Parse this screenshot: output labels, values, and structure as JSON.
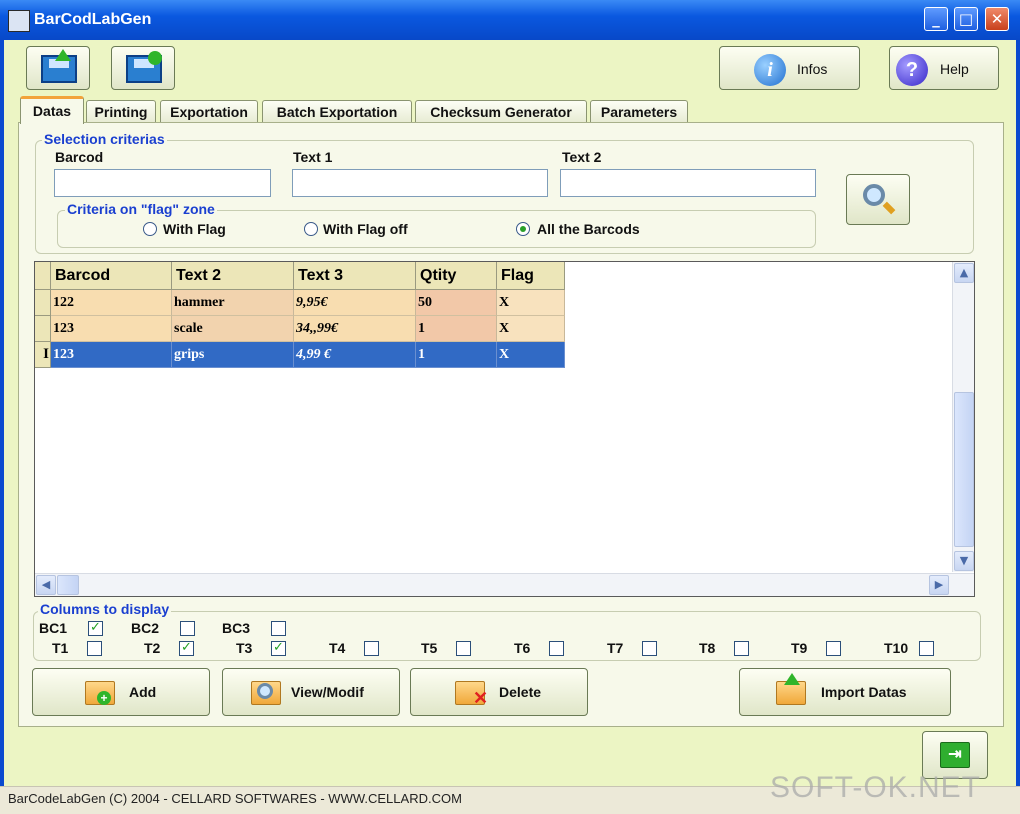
{
  "window": {
    "title": "BarCodLabGen"
  },
  "toolbar": {
    "infos_label": "Infos",
    "help_label": "Help"
  },
  "tabs": [
    {
      "label": "Datas",
      "active": true
    },
    {
      "label": "Printing"
    },
    {
      "label": "Exportation"
    },
    {
      "label": "Batch Exportation"
    },
    {
      "label": "Checksum Generator"
    },
    {
      "label": "Parameters"
    }
  ],
  "selection": {
    "title": "Selection criterias",
    "barcod_label": "Barcod",
    "text1_label": "Text 1",
    "text2_label": "Text 2",
    "barcod_value": "",
    "text1_value": "",
    "text2_value": ""
  },
  "flag_zone": {
    "title": "Criteria on \"flag\" zone",
    "options": [
      "With Flag",
      "With Flag off",
      "All the Barcods"
    ],
    "selected": "All the Barcods"
  },
  "grid": {
    "columns": [
      "Barcod",
      "Text 2",
      "Text 3",
      "Qtity",
      "Flag"
    ],
    "rows": [
      [
        "122",
        "hammer",
        "9,95€",
        "50",
        "X"
      ],
      [
        "123",
        "scale",
        "34,,99€",
        "1",
        "X"
      ],
      [
        "123",
        "grips",
        "4,99 €",
        "1",
        "X"
      ]
    ],
    "selected_row": 2,
    "row_marker": "I"
  },
  "columns_display": {
    "title": "Columns to display",
    "row1": [
      {
        "label": "BC1",
        "checked": true
      },
      {
        "label": "BC2",
        "checked": false
      },
      {
        "label": "BC3",
        "checked": false
      }
    ],
    "row2": [
      {
        "label": "T1",
        "checked": false
      },
      {
        "label": "T2",
        "checked": true
      },
      {
        "label": "T3",
        "checked": true
      },
      {
        "label": "T4",
        "checked": false
      },
      {
        "label": "T5",
        "checked": false
      },
      {
        "label": "T6",
        "checked": false
      },
      {
        "label": "T7",
        "checked": false
      },
      {
        "label": "T8",
        "checked": false
      },
      {
        "label": "T9",
        "checked": false
      },
      {
        "label": "T10",
        "checked": false
      }
    ]
  },
  "actions": {
    "add": "Add",
    "view": "View/Modif",
    "delete": "Delete",
    "import": "Import Datas"
  },
  "status": {
    "text": "BarCodeLabGen (C) 2004 - CELLARD SOFTWARES - WWW.CELLARD.COM"
  },
  "watermark": "SOFT-OK.NET",
  "colors": {
    "title_bar": "#0A58E0",
    "client_bg": "#ECF5C4",
    "row_peach": "#F8DDB0",
    "row_selected": "#316AC5",
    "group_title": "#1A3FD0"
  }
}
